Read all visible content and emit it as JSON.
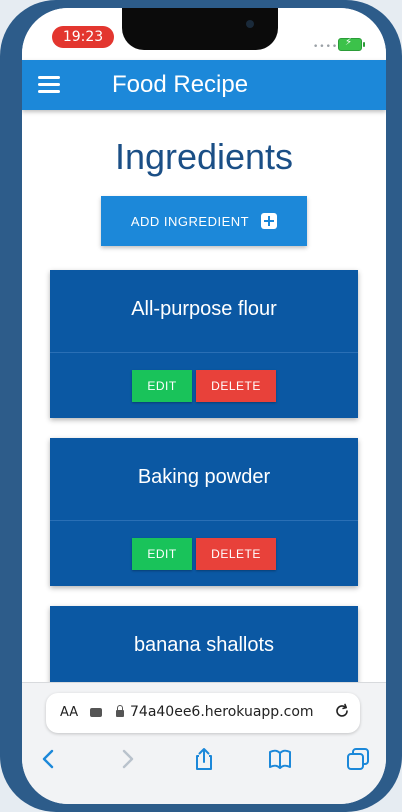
{
  "status_bar": {
    "time": "19:23"
  },
  "app_bar": {
    "title": "Food Recipe"
  },
  "page": {
    "title": "Ingredients",
    "add_label": "ADD INGREDIENT"
  },
  "ingredients": [
    {
      "name": "All-purpose flour",
      "edit_label": "EDIT",
      "delete_label": "DELETE"
    },
    {
      "name": "Baking powder",
      "edit_label": "EDIT",
      "delete_label": "DELETE"
    },
    {
      "name": "banana shallots"
    }
  ],
  "browser": {
    "aa_label": "AA",
    "url": "74a40ee6.herokuapp.com"
  },
  "colors": {
    "accent": "#1c88d9",
    "card": "#0b58a3",
    "edit": "#19c35a",
    "delete": "#e8413a",
    "title": "#1b4f86"
  },
  "icons": [
    "menu-icon",
    "plus-icon",
    "lock-icon",
    "reload-icon",
    "back-icon",
    "forward-icon",
    "share-icon",
    "bookmarks-icon",
    "tabs-icon"
  ]
}
